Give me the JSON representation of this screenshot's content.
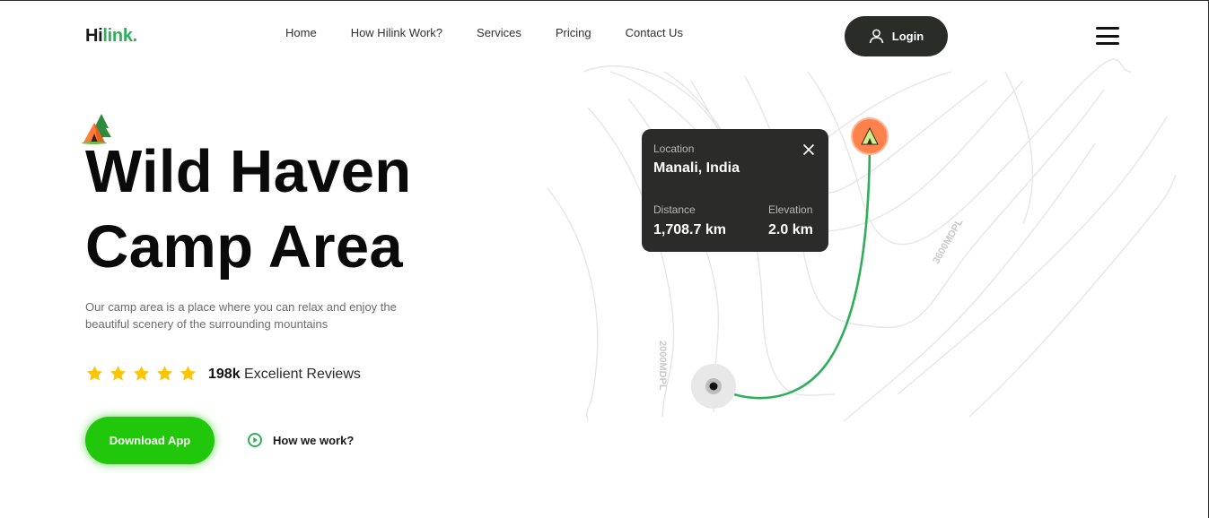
{
  "header": {
    "logo_main": "Hi",
    "logo_accent": "link.",
    "nav": [
      "Home",
      "How Hilink Work?",
      "Services",
      "Pricing",
      "Contact Us"
    ],
    "login_label": "Login"
  },
  "hero": {
    "title_line1": "Wild Haven",
    "title_line2": "Camp Area",
    "description": "Our camp area is a place where you can relax and enjoy the beautiful scenery of the surrounding mountains",
    "rating_stars": 5,
    "reviews_count": "198k",
    "reviews_label": "Excelient Reviews",
    "download_label": "Download App",
    "how_label": "How we work?"
  },
  "map": {
    "contour_labels": [
      "3600MDPL",
      "2000MDPL"
    ],
    "card": {
      "location_label": "Location",
      "location_value": "Manali, India",
      "distance_label": "Distance",
      "distance_value": "1,708.7 km",
      "elevation_label": "Elevation",
      "elevation_value": "2.0 km"
    }
  },
  "colors": {
    "brand_green": "#30af5b",
    "button_green": "#21c70b",
    "dark": "#292c27",
    "star": "#fec601",
    "pin": "#ff814c"
  },
  "icons": [
    "user-icon",
    "hamburger-icon",
    "tent-icon",
    "star-icon",
    "play-icon",
    "close-icon",
    "pin-icon"
  ]
}
